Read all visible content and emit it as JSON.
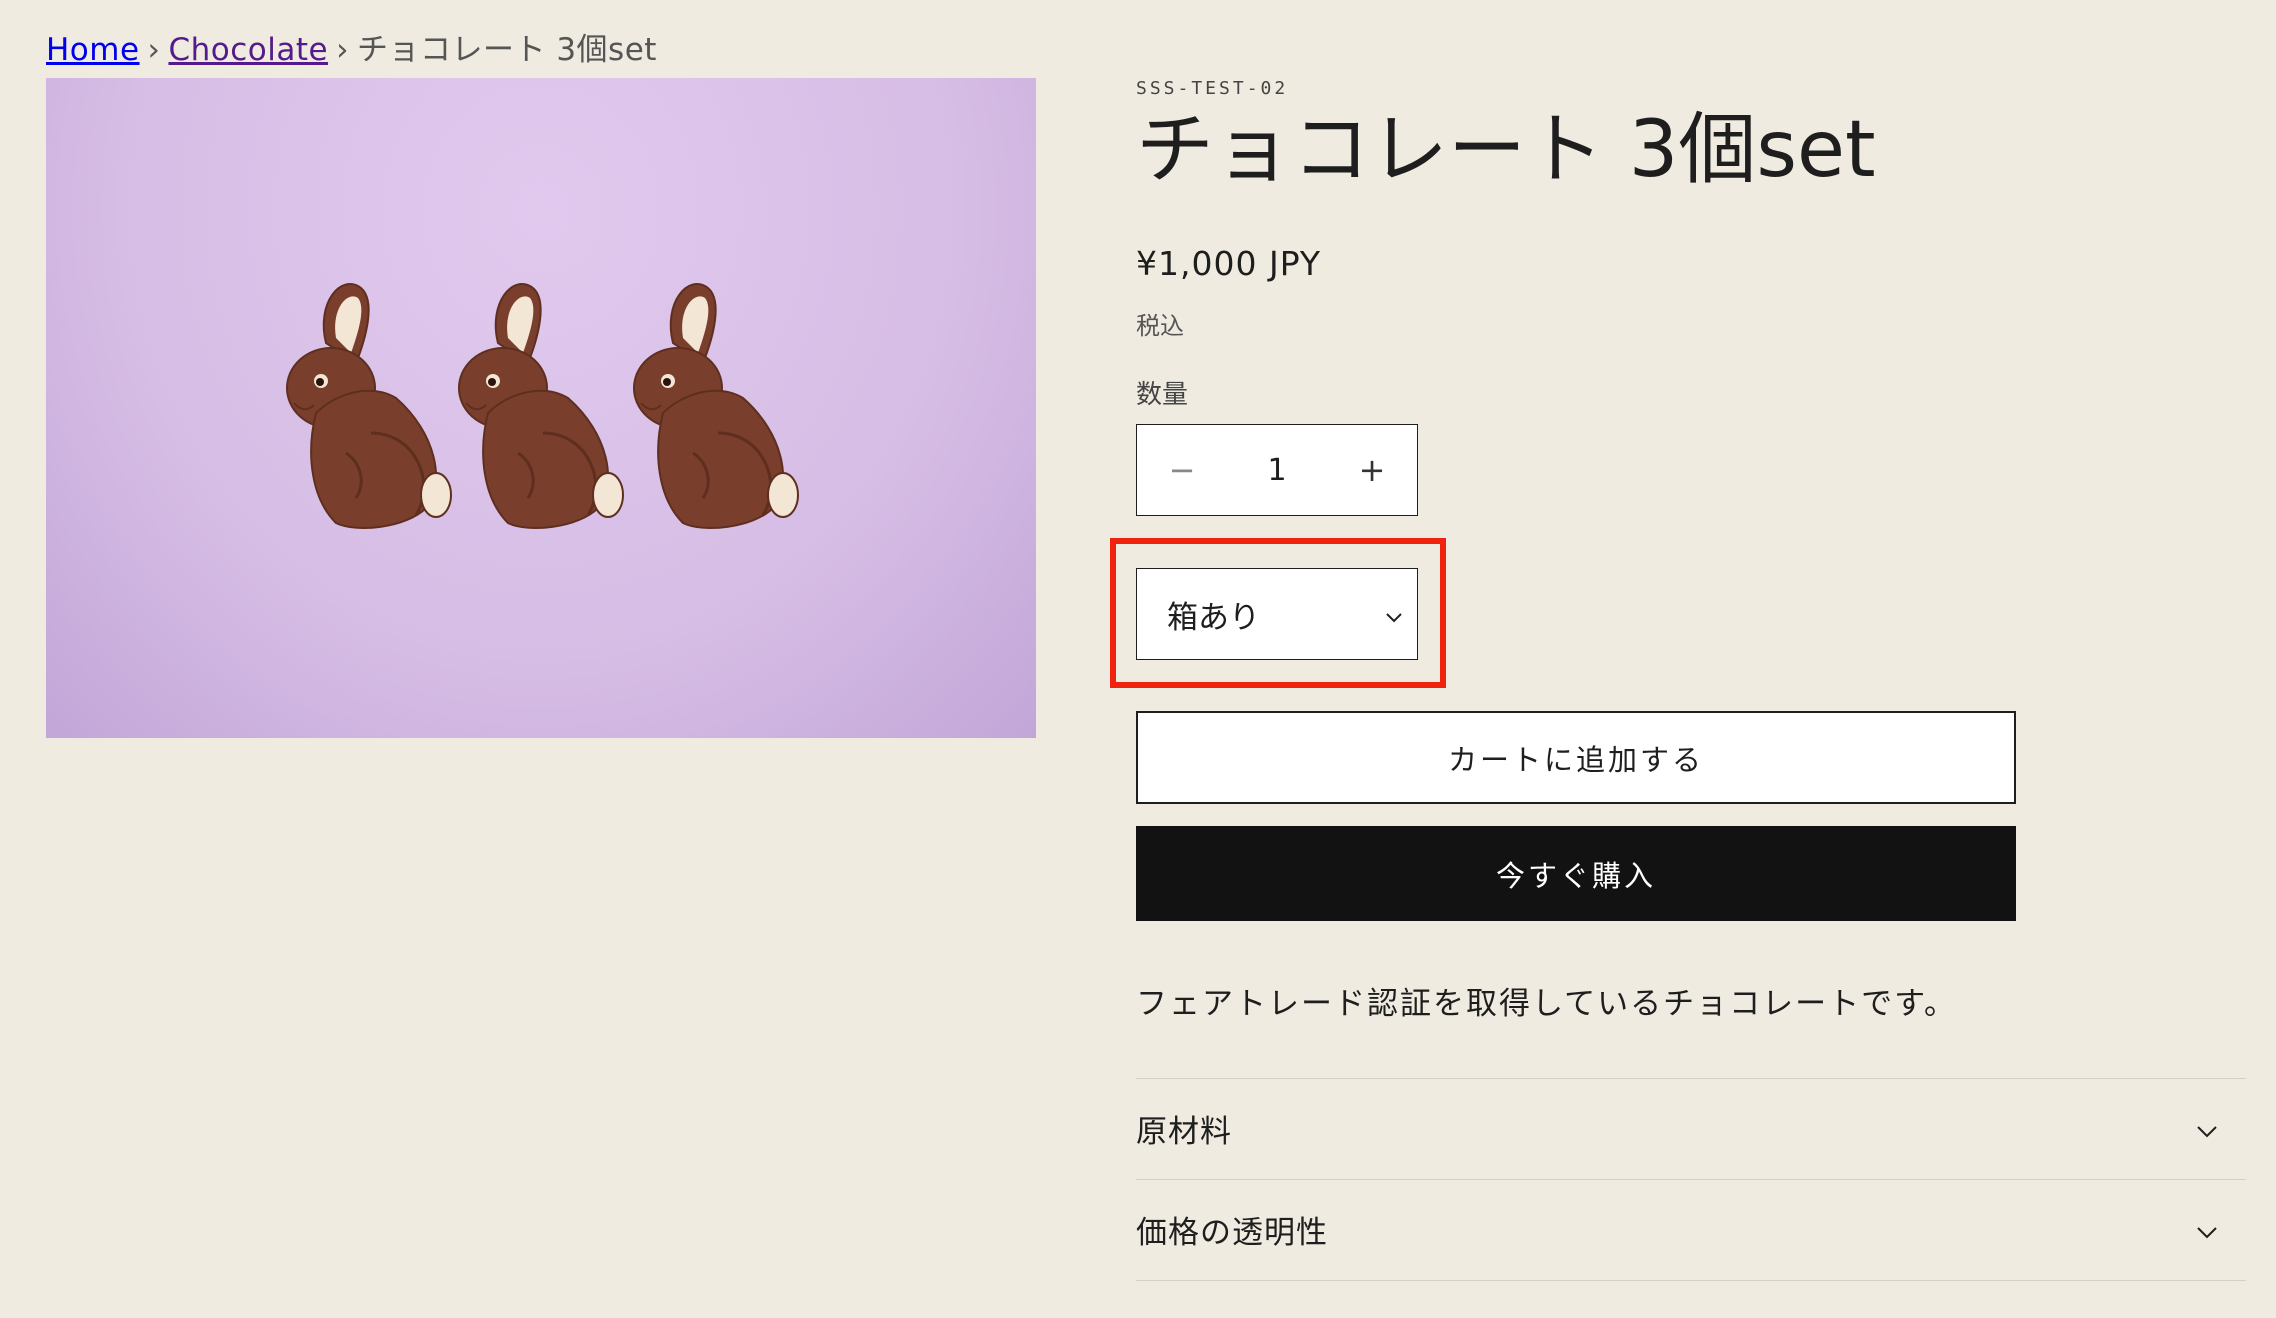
{
  "breadcrumb": {
    "home": "Home",
    "category": "Chocolate",
    "separator": "›",
    "current": "チョコレート 3個set"
  },
  "product": {
    "sku": "SSS-TEST-02",
    "title": "チョコレート 3個set",
    "price": "¥1,000 JPY",
    "tax_note": "税込",
    "quantity_label": "数量",
    "quantity_value": "1",
    "variant_selected": "箱あり",
    "add_to_cart": "カートに追加する",
    "buy_now": "今すぐ購入",
    "description": "フェアトレード認証を取得しているチョコレートです。",
    "image_description": "three-chocolate-bunnies"
  },
  "accordions": [
    {
      "label": "原材料"
    },
    {
      "label": "価格の透明性"
    }
  ],
  "icons": {
    "minus": "−",
    "plus": "+"
  },
  "colors": {
    "background": "#efebe0",
    "buy_button": "#121212",
    "highlight": "#f0230f",
    "image_bg": "#d6bde5",
    "chocolate": "#7a3f2c"
  }
}
